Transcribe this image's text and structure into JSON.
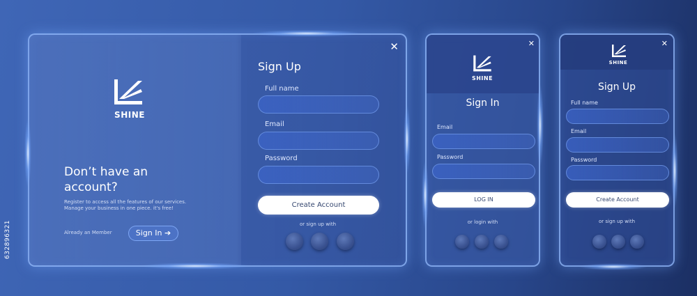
{
  "brand": {
    "name": "SHINE"
  },
  "desktop": {
    "left": {
      "heading": "Don’t have an account?",
      "subtitle": "Register to access all the features of our services. Manage your business in one piece. it's free!",
      "already_member": "Already an Member",
      "signin_button": "Sign In"
    },
    "form": {
      "title": "Sign Up",
      "fullname_label": "Full name",
      "email_label": "Email",
      "password_label": "Password",
      "create_button": "Create Account",
      "social_text": "or sign up with",
      "close": "✕"
    }
  },
  "signin_mobile": {
    "title": "Sign In",
    "email_label": "Email",
    "password_label": "Password",
    "login_button": "LOG IN",
    "social_text": "or login with",
    "close": "✕"
  },
  "signup_mobile": {
    "title": "Sign Up",
    "fullname_label": "Full name",
    "email_label": "Email",
    "password_label": "Password",
    "create_button": "Create Account",
    "social_text": "or sign up with",
    "close": "✕"
  },
  "watermark_id": "632896321",
  "colors": {
    "accent_border": "#96beff",
    "field_fill": "#3c64c8",
    "button_fill": "#ffffff",
    "button_text": "#34466f"
  },
  "icons": {
    "logo": "shine-logo-icon",
    "arrow": "arrow-right-icon",
    "close": "close-icon",
    "social": "social-circle-icon"
  }
}
